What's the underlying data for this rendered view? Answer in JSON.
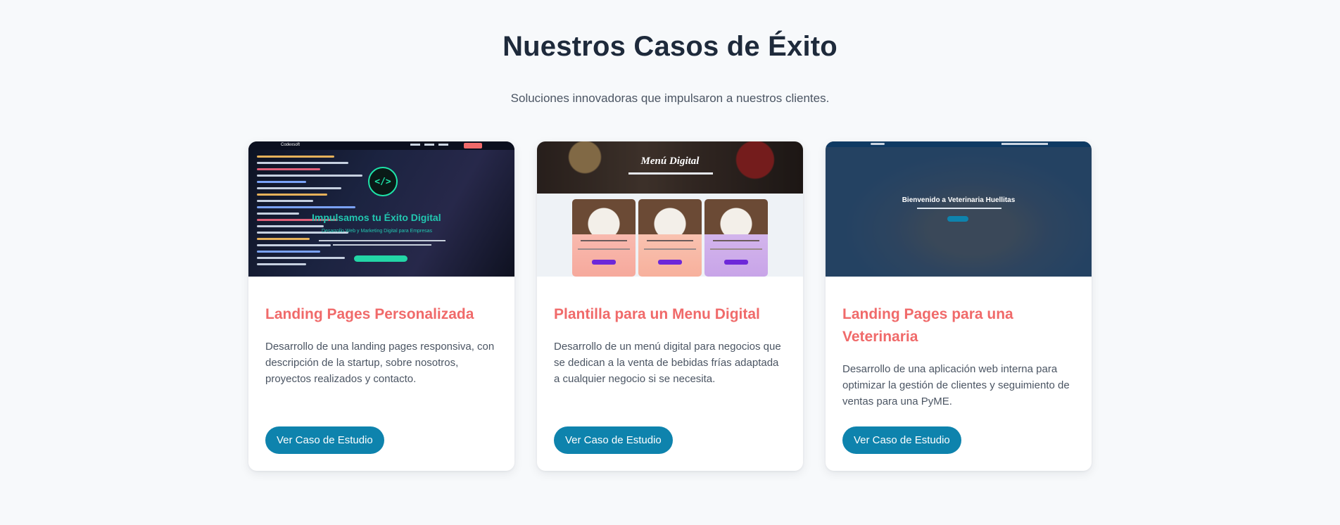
{
  "section": {
    "title": "Nuestros Casos de Éxito",
    "subtitle": "Soluciones innovadoras que impulsaron a nuestros clientes."
  },
  "cards": [
    {
      "title": "Landing Pages Personalizada",
      "description": "Desarrollo de una landing pages responsiva, con descripción de la startup, sobre nosotros, proyectos realizados y contacto.",
      "button_label": "Ver Caso de Estudio",
      "thumbnail": {
        "brand": "Codexsoft",
        "hero_title": "Impulsamos tu Éxito Digital",
        "hero_subtitle": "Desarrollo Web y Marketing Digital para Empresas",
        "logo_glyph": "</>"
      }
    },
    {
      "title": "Plantilla para un Menu Digital",
      "description": "Desarrollo de un menú digital para negocios que se dedican a la venta de bebidas frías adaptada a cualquier negocio si se necesita.",
      "button_label": "Ver Caso de Estudio",
      "thumbnail": {
        "banner_title": "Menú Digital"
      }
    },
    {
      "title": "Landing Pages para una Veterinaria",
      "description": "Desarrollo de una aplicación web interna para optimizar la gestión de clientes y seguimiento de ventas para una PyME.",
      "button_label": "Ver Caso de Estudio",
      "thumbnail": {
        "hero_title": "Bienvenido a Veterinaria Huellitas"
      }
    }
  ],
  "colors": {
    "title": "#1e2a3b",
    "card_title": "#f06a6a",
    "button": "#0e83ad",
    "background": "#f7f9fb"
  }
}
